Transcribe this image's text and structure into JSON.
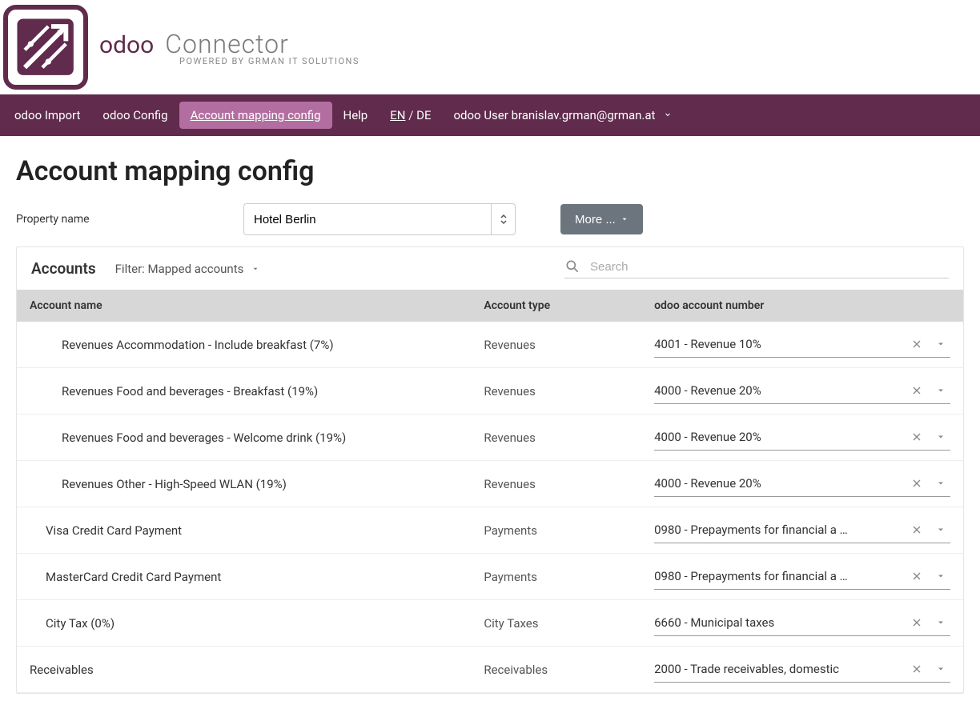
{
  "brand": {
    "odoo": "odoo",
    "connector": "Connector",
    "sub": "POWERED BY GRMAN IT SOLUTIONS"
  },
  "nav": {
    "import": "odoo Import",
    "config": "odoo Config",
    "mapping": "Account mapping config",
    "help": "Help",
    "lang_en": "EN",
    "lang_sep": " / ",
    "lang_de": "DE",
    "user_label": "odoo User ",
    "user_email": "branislav.grman@grman.at"
  },
  "page": {
    "title": "Account mapping config",
    "property_label": "Property name",
    "property_value": "Hotel Berlin",
    "more_btn": "More ..."
  },
  "card": {
    "title": "Accounts",
    "filter_label": "Filter: Mapped accounts",
    "search_placeholder": "Search"
  },
  "columns": {
    "name": "Account name",
    "type": "Account type",
    "acct": "odoo account number"
  },
  "rows": [
    {
      "indent": 2,
      "name": "Revenues Accommodation - Include breakfast (7%)",
      "type": "Revenues",
      "acct": "4001 - Revenue 10%"
    },
    {
      "indent": 2,
      "name": "Revenues Food and beverages - Breakfast (19%)",
      "type": "Revenues",
      "acct": "4000 - Revenue 20%"
    },
    {
      "indent": 2,
      "name": "Revenues Food and beverages - Welcome drink (19%)",
      "type": "Revenues",
      "acct": "4000 - Revenue 20%"
    },
    {
      "indent": 2,
      "name": "Revenues Other - High-Speed WLAN (19%)",
      "type": "Revenues",
      "acct": "4000 - Revenue 20%"
    },
    {
      "indent": 1,
      "name": "Visa Credit Card Payment",
      "type": "Payments",
      "acct": "0980 - Prepayments for financial a …"
    },
    {
      "indent": 1,
      "name": "MasterCard Credit Card Payment",
      "type": "Payments",
      "acct": "0980 - Prepayments for financial a …"
    },
    {
      "indent": 1,
      "name": "City Tax (0%)",
      "type": "City Taxes",
      "acct": "6660 - Municipal taxes"
    },
    {
      "indent": 0,
      "name": "Receivables",
      "type": "Receivables",
      "acct": "2000 - Trade receivables, domestic"
    }
  ]
}
